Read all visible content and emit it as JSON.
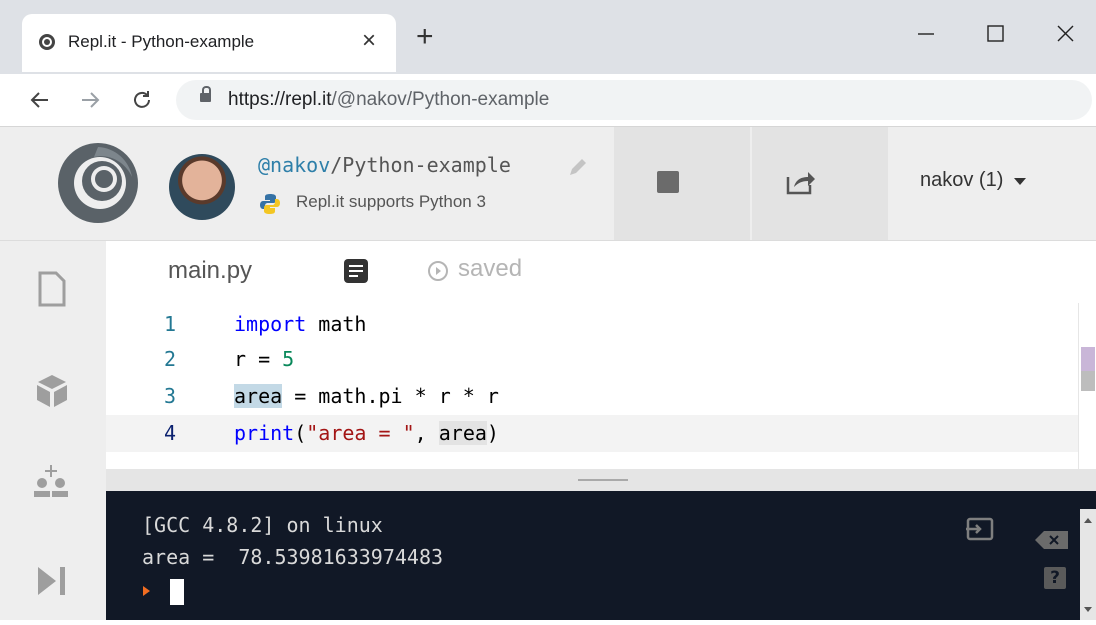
{
  "browser": {
    "tab_title": "Repl.it - Python-example",
    "tab_close": "×",
    "new_tab": "+",
    "url_host": "https://repl.it",
    "url_path": "/@nakov/Python-example",
    "icons": [
      "back-arrow-icon",
      "forward-arrow-icon",
      "reload-icon",
      "lock-icon",
      "minimize-icon",
      "maximize-icon",
      "close-window-icon"
    ]
  },
  "repl": {
    "user": "@nakov",
    "separator_name": "/Python-example",
    "subtitle": "Repl.it supports Python 3",
    "account_label": "nakov (1)"
  },
  "editor": {
    "file_tab": "main.py",
    "status": "saved",
    "lines": [
      {
        "num": "1"
      },
      {
        "num": "2"
      },
      {
        "num": "3"
      },
      {
        "num": "4"
      }
    ],
    "tokens": {
      "l1_kw": "import",
      "l1_rest": " math",
      "l2_a": "r = ",
      "l2_num": "5",
      "l3_hl": "area",
      "l3_rest": " = math.pi * r * r",
      "l4_kw": "print",
      "l4_paren": "(",
      "l4_str": "\"area = \"",
      "l4_comma": ", ",
      "l4_hl": "area",
      "l4_close": ")"
    }
  },
  "console": {
    "line1": "[GCC 4.8.2] on linux",
    "line2": "area =  78.53981633974483",
    "help": "?"
  },
  "colors": {
    "console_bg": "#111826",
    "prompt_accent": "#f26d21",
    "link_blue": "#2e7fa9"
  }
}
